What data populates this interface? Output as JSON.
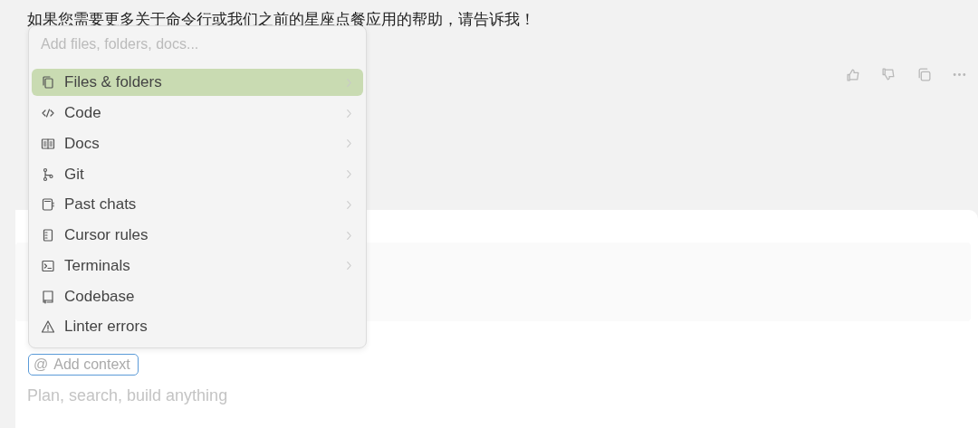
{
  "message": {
    "text": "如果您需要更多关于命令行或我们之前的星座点餐应用的帮助，请告诉我！"
  },
  "context_menu": {
    "search": {
      "placeholder": "Add files, folders, docs..."
    },
    "items": [
      {
        "label": "Files & folders",
        "selected": true,
        "has_submenu": true
      },
      {
        "label": "Code",
        "selected": false,
        "has_submenu": true
      },
      {
        "label": "Docs",
        "selected": false,
        "has_submenu": true
      },
      {
        "label": "Git",
        "selected": false,
        "has_submenu": true
      },
      {
        "label": "Past chats",
        "selected": false,
        "has_submenu": true
      },
      {
        "label": "Cursor rules",
        "selected": false,
        "has_submenu": true
      },
      {
        "label": "Terminals",
        "selected": false,
        "has_submenu": true
      },
      {
        "label": "Codebase",
        "selected": false,
        "has_submenu": false
      },
      {
        "label": "Linter errors",
        "selected": false,
        "has_submenu": false
      }
    ]
  },
  "composer": {
    "context_button": {
      "symbol": "@",
      "label": "Add context"
    },
    "input": {
      "placeholder": "Plan, search, build anything"
    }
  }
}
